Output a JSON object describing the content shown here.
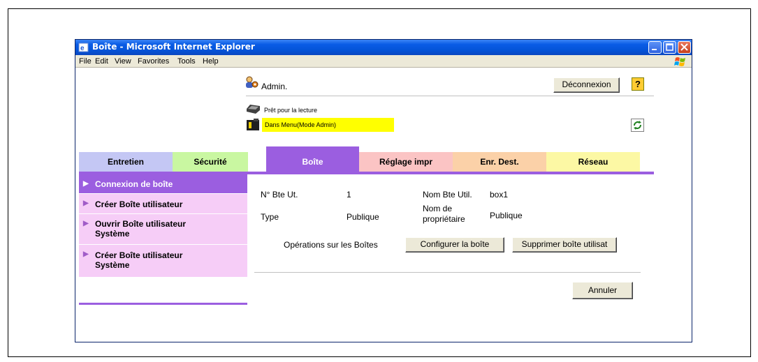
{
  "window": {
    "title": "Boîte - Microsoft Internet Explorer"
  },
  "menu": [
    "File",
    "Edit",
    "View",
    "Favorites",
    "Tools",
    "Help"
  ],
  "header": {
    "user": "Admin.",
    "logout": "Déconnexion",
    "help": "?",
    "status_ready": "Prêt pour la lecture",
    "status_mode": "Dans Menu(Mode Admin)"
  },
  "tabs": [
    "Entretien",
    "Sécurité",
    "Boîte",
    "Réglage impr",
    "Enr. Dest.",
    "Réseau"
  ],
  "sidebar": [
    {
      "label": "Connexion de boîte"
    },
    {
      "label": "Créer Boîte utilisateur"
    },
    {
      "label": "Ouvrir Boîte utilisateur Système"
    },
    {
      "label": "Créer Boîte utilisateur Système"
    }
  ],
  "box": {
    "number_label": "N° Bte Ut.",
    "number_value": "1",
    "name_label": "Nom Bte Util.",
    "name_value": "box1",
    "type_label": "Type",
    "type_value": "Publique",
    "owner_label": "Nom de propriétaire",
    "owner_value": "Publique",
    "ops_label": "Opérations sur les Boîtes",
    "configure": "Configurer la boîte",
    "delete": "Supprimer boîte utilisat",
    "cancel": "Annuler"
  },
  "colors": {
    "accent": "#9b5ee0",
    "sidebar": "#f6cdf7",
    "titlebar": "#0453d7"
  }
}
